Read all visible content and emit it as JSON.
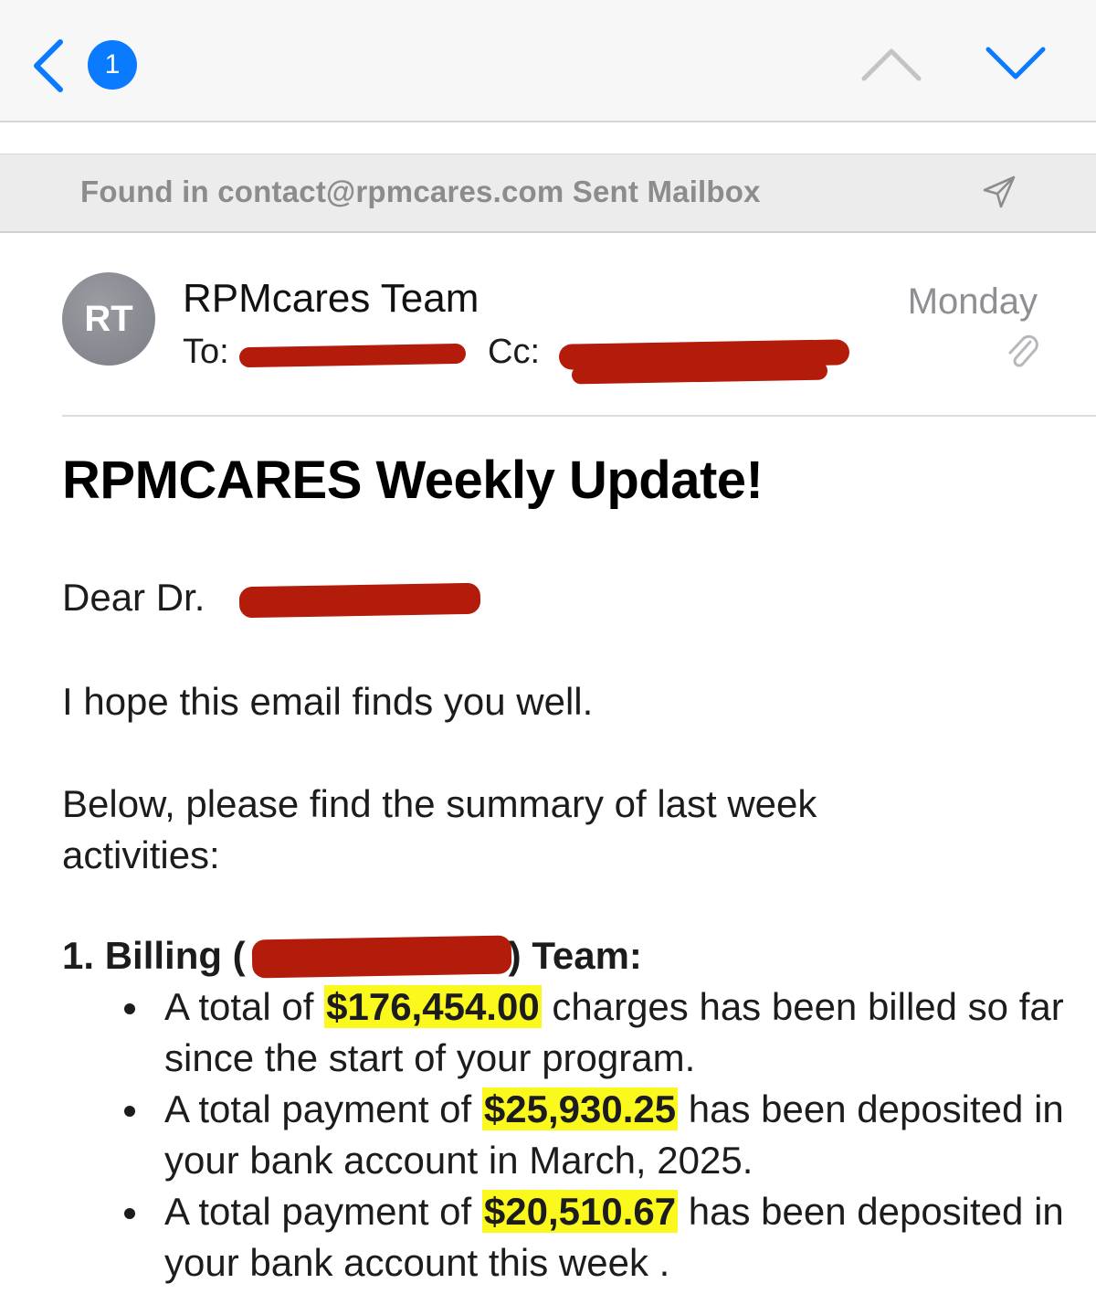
{
  "nav": {
    "back_icon": "chevron-left-icon",
    "unread_count": "1",
    "prev_icon": "chevron-up-icon",
    "next_icon": "chevron-down-icon",
    "accent_color": "#0a7aff"
  },
  "mailbox_notice": {
    "text": "Found in contact@rpmcares.com Sent Mailbox",
    "icon": "send-icon"
  },
  "header": {
    "avatar_initials": "RT",
    "sender": "RPMcares Team",
    "date": "Monday",
    "to_label": "To:",
    "cc_label": "Cc:",
    "attachment_icon": "paperclip-icon"
  },
  "body": {
    "subject": "RPMCARES Weekly Update!",
    "greeting": "Dear Dr.",
    "intro": "I hope this email finds you well.",
    "summary_intro": "Below, please find the summary of last week activities:",
    "section": {
      "title_start": "1. Billing (",
      "title_end": ") Team:",
      "items": [
        {
          "pre": "A total of ",
          "amount": "$176,454.00",
          "post": " charges has been billed so far since the start of your program."
        },
        {
          "pre": "A total payment of ",
          "amount": "$25,930.25",
          "post": " has been deposited in your bank account in March, 2025."
        },
        {
          "pre": "A total payment of ",
          "amount": "$20,510.67",
          "post": " has been deposited in your bank account this week ."
        }
      ]
    },
    "highlight_color": "#fbf81e",
    "redaction_color": "#b31b0a"
  }
}
